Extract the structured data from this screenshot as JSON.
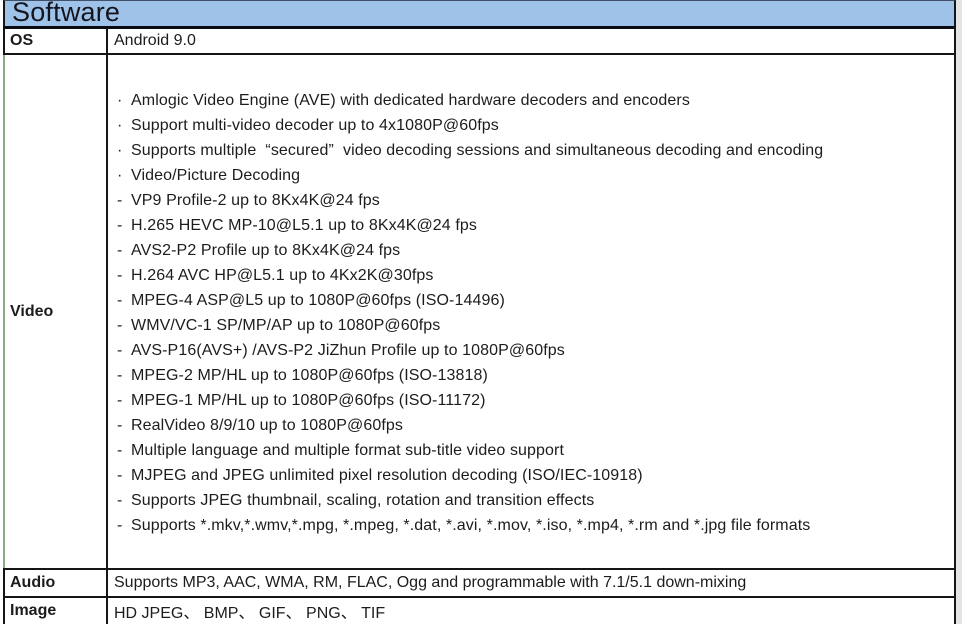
{
  "title": "Software",
  "colors": {
    "header_bg": "#9fc3e8",
    "border": "#151515",
    "video_left_border": "#8fa887",
    "text": "#1c1c1c"
  },
  "rows": {
    "os": {
      "label": "OS",
      "value": "Android 9.0"
    },
    "video": {
      "label": "Video",
      "lines": [
        {
          "b": "·",
          "t": "Amlogic Video Engine (AVE) with dedicated hardware decoders and encoders"
        },
        {
          "b": "·",
          "t": "Support multi-video decoder up to 4x1080P@60fps"
        },
        {
          "b": "·",
          "t": "Supports multiple  “secured”  video decoding sessions and simultaneous decoding and encoding"
        },
        {
          "b": "·",
          "t": "Video/Picture Decoding"
        },
        {
          "b": "-",
          "t": "VP9 Profile-2 up to 8Kx4K@24 fps"
        },
        {
          "b": "-",
          "t": "H.265 HEVC MP-10@L5.1 up to 8Kx4K@24 fps"
        },
        {
          "b": "-",
          "t": "AVS2-P2 Profile up to 8Kx4K@24 fps"
        },
        {
          "b": "-",
          "t": "H.264 AVC HP@L5.1 up to 4Kx2K@30fps"
        },
        {
          "b": "-",
          "t": "MPEG-4 ASP@L5 up to 1080P@60fps (ISO-14496)"
        },
        {
          "b": "-",
          "t": "WMV/VC-1 SP/MP/AP up to 1080P@60fps"
        },
        {
          "b": "-",
          "t": "AVS-P16(AVS+) /AVS-P2 JiZhun Profile up to 1080P@60fps"
        },
        {
          "b": "-",
          "t": "MPEG-2 MP/HL up to 1080P@60fps (ISO-13818)"
        },
        {
          "b": "-",
          "t": "MPEG-1 MP/HL up to 1080P@60fps (ISO-11172)"
        },
        {
          "b": "-",
          "t": "RealVideo 8/9/10 up to 1080P@60fps"
        },
        {
          "b": "-",
          "t": "Multiple language and multiple format sub-title video support"
        },
        {
          "b": "-",
          "t": "MJPEG and JPEG unlimited pixel resolution decoding (ISO/IEC-10918)"
        },
        {
          "b": "-",
          "t": "Supports JPEG thumbnail, scaling, rotation and transition effects"
        },
        {
          "b": "-",
          "t": "Supports *.mkv,*.wmv,*.mpg, *.mpeg, *.dat, *.avi, *.mov, *.iso, *.mp4, *.rm and *.jpg file formats"
        }
      ]
    },
    "audio": {
      "label": "Audio",
      "value": "Supports MP3, AAC, WMA, RM, FLAC, Ogg and programmable with 7.1/5.1 down-mixing"
    },
    "image": {
      "label": "Image",
      "value": "HD JPEG、 BMP、 GIF、 PNG、 TIF"
    }
  }
}
